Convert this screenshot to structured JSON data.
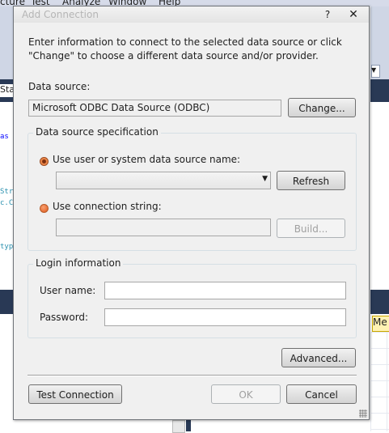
{
  "background": {
    "menu_items": [
      "cture",
      "Test",
      "Analyze",
      "Window",
      "Help"
    ],
    "tab_fragment": "Stam",
    "code_fragments": [
      "as s",
      "Str",
      "c.C",
      "type"
    ],
    "me_tab": "Me"
  },
  "dialog": {
    "title": "Add Connection",
    "help_glyph": "?",
    "close_glyph": "✕",
    "intro_text": "Enter information to connect to the selected data source or click \"Change\" to choose a different data source and/or provider.",
    "data_source": {
      "label": "Data source:",
      "value": "Microsoft ODBC Data Source (ODBC)",
      "change_button": "Change..."
    },
    "spec": {
      "group_title": "Data source specification",
      "use_dsn_label": "Use user or system data source name:",
      "use_dsn_selected": true,
      "dsn_value": "",
      "refresh_button": "Refresh",
      "use_conn_string_label": "Use connection string:",
      "conn_string_value": "",
      "build_button": "Build..."
    },
    "login": {
      "group_title": "Login information",
      "username_label": "User name:",
      "username_value": "",
      "password_label": "Password:",
      "password_value": ""
    },
    "advanced_button": "Advanced...",
    "test_button": "Test Connection",
    "ok_button": "OK",
    "cancel_button": "Cancel"
  },
  "colors": {
    "ide_dark": "#293955",
    "radio_orange": "#e05a1e",
    "dialog_bg": "#f0f0f0"
  }
}
